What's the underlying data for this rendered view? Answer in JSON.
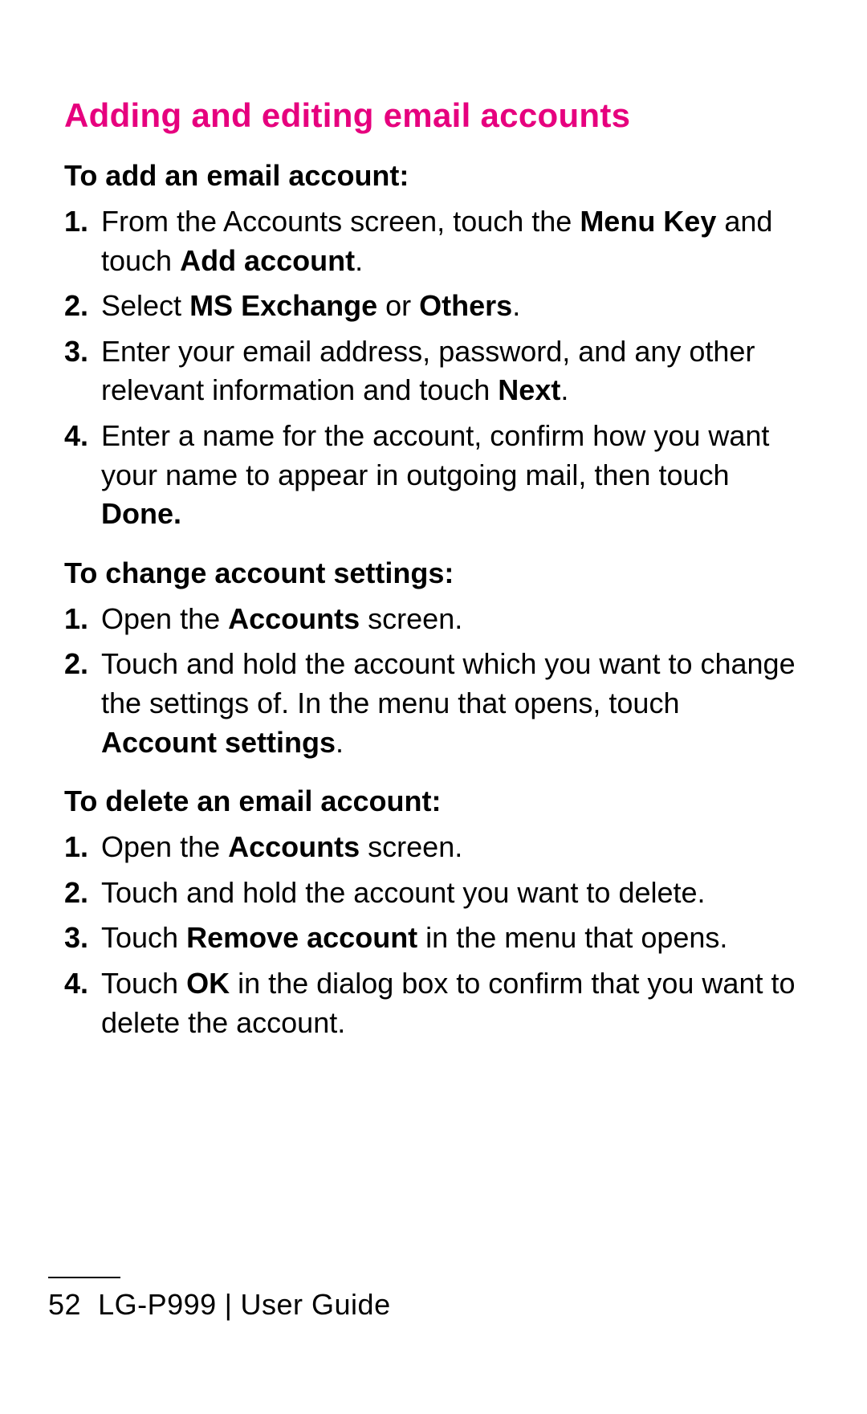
{
  "title": "Adding and editing email accounts",
  "sections": [
    {
      "heading": "To add an email account:",
      "steps": [
        {
          "num": "1.",
          "pre": "From the Accounts screen, touch the ",
          "b1": "Menu Key",
          "mid": " and touch ",
          "b2": "Add account",
          "post": "."
        },
        {
          "num": "2.",
          "pre": "Select ",
          "b1": "MS Exchange",
          "mid": " or ",
          "b2": "Others",
          "post": "."
        },
        {
          "num": "3.",
          "pre": "Enter your email address, password, and any other relevant information and touch ",
          "b1": "Next",
          "mid": "",
          "b2": "",
          "post": "."
        },
        {
          "num": "4.",
          "pre": "Enter a name for the account, confirm how you want your name to appear in outgoing mail, then touch ",
          "b1": "Done.",
          "mid": "",
          "b2": "",
          "post": ""
        }
      ]
    },
    {
      "heading": "To change account settings:",
      "steps": [
        {
          "num": "1.",
          "pre": "Open the ",
          "b1": "Accounts",
          "mid": " screen.",
          "b2": "",
          "post": ""
        },
        {
          "num": "2.",
          "pre": "Touch and hold the account which you want to change the settings of. In the menu that opens, touch ",
          "b1": "Account settings",
          "mid": ".",
          "b2": "",
          "post": ""
        }
      ]
    },
    {
      "heading": "To delete an email account:",
      "steps": [
        {
          "num": "1.",
          "pre": "Open the ",
          "b1": "Accounts",
          "mid": " screen.",
          "b2": "",
          "post": ""
        },
        {
          "num": "2.",
          "pre": "Touch and hold the account you want to delete.",
          "b1": "",
          "mid": "",
          "b2": "",
          "post": ""
        },
        {
          "num": "3.",
          "pre": "Touch ",
          "b1": "Remove account",
          "mid": " in the menu that opens.",
          "b2": "",
          "post": ""
        },
        {
          "num": "4.",
          "pre": "Touch ",
          "b1": "OK",
          "mid": " in the dialog box to confirm that you want to delete the account.",
          "b2": "",
          "post": ""
        }
      ]
    }
  ],
  "footer": {
    "page": "52",
    "model": "LG-P999",
    "sep": "|",
    "label": "User Guide"
  }
}
